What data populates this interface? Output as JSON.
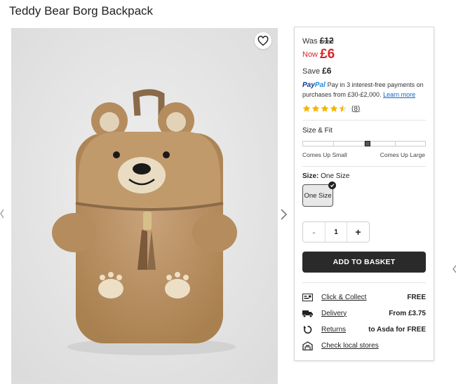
{
  "product": {
    "title": "Teddy Bear Borg Backpack"
  },
  "pricing": {
    "was_label": "Was",
    "was_price": "£12",
    "now_label": "Now",
    "now_price": "£6",
    "save_label": "Save",
    "save_amount": "£6",
    "sale_color": "#d9252a"
  },
  "paypal": {
    "logo_pay": "Pay",
    "logo_pal": "Pal",
    "text": "Pay in 3 interest-free payments on purchases from £30-£2,000.",
    "link": "Learn more"
  },
  "rating": {
    "stars": 4.5,
    "max": 5,
    "count": "(8)",
    "star_color": "#f4b400"
  },
  "size_fit": {
    "label": "Size & Fit",
    "left_label": "Comes Up Small",
    "right_label": "Comes Up Large",
    "position": 0.53
  },
  "size": {
    "label": "Size:",
    "selected": "One Size",
    "options": [
      "One Size"
    ]
  },
  "quantity": {
    "minus": "-",
    "value": "1",
    "plus": "+"
  },
  "add_to_basket": "ADD TO BASKET",
  "delivery": [
    {
      "icon": "click-collect-icon",
      "label": "Click & Collect",
      "value": "FREE"
    },
    {
      "icon": "truck-icon",
      "label": "Delivery",
      "value": "From £3.75"
    },
    {
      "icon": "returns-icon",
      "label": "Returns",
      "value": "to Asda for FREE"
    },
    {
      "icon": "store-icon",
      "label": "Check local stores",
      "value": ""
    }
  ]
}
